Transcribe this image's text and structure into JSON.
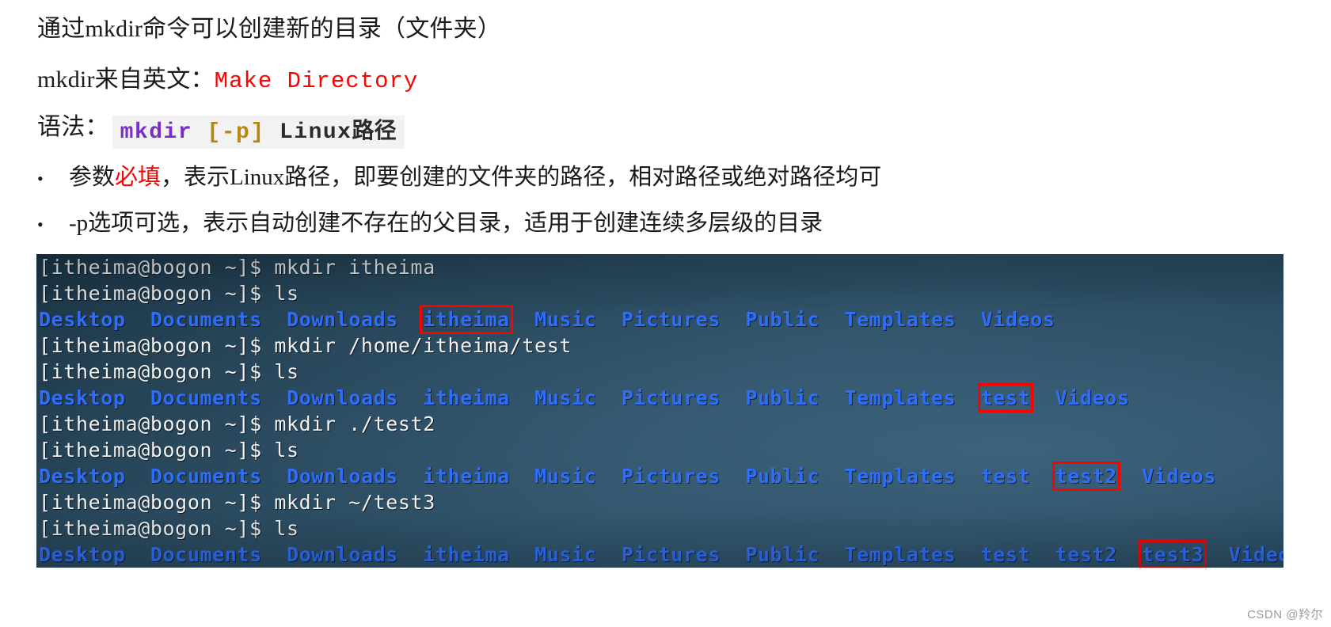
{
  "slide": {
    "heading_1": "通过mkdir命令可以创建新的目录（文件夹）",
    "line2_prefix": "mkdir来自英文：",
    "line2_english": "Make Directory",
    "line3_prefix": "语法：",
    "syntax": {
      "command": "mkdir",
      "space1": " ",
      "option": "[-p]",
      "space2": " ",
      "arg_latin": "Linux",
      "arg_cjk": "路径"
    },
    "bullets": [
      {
        "marker": "•",
        "pre": "参数",
        "emphasis": "必填",
        "post": "，表示Linux路径，即要创建的文件夹的路径，相对路径或绝对路径均可"
      },
      {
        "marker": "•",
        "pre": "-p选项可选，表示自动创建不存在的父目录，适用于创建连续多层级的目录",
        "emphasis": "",
        "post": ""
      }
    ]
  },
  "terminal": {
    "prompt": "[itheima@bogon ~]$ ",
    "colors": {
      "background": "#2c4a60",
      "prompt_text": "#f2f2f2",
      "directory": "#2f6dfb",
      "highlight_box": "#ff0000"
    },
    "lines": [
      {
        "kind": "command",
        "prompt": "[itheima@bogon ~]$ ",
        "command": "mkdir itheima"
      },
      {
        "kind": "command",
        "prompt": "[itheima@bogon ~]$ ",
        "command": "ls"
      },
      {
        "kind": "listing",
        "items": [
          "Desktop",
          "Documents",
          "Downloads",
          "itheima",
          "Music",
          "Pictures",
          "Public",
          "Templates",
          "Videos"
        ],
        "highlight": "itheima"
      },
      {
        "kind": "command",
        "prompt": "[itheima@bogon ~]$ ",
        "command": "mkdir /home/itheima/test"
      },
      {
        "kind": "command",
        "prompt": "[itheima@bogon ~]$ ",
        "command": "ls"
      },
      {
        "kind": "listing",
        "items": [
          "Desktop",
          "Documents",
          "Downloads",
          "itheima",
          "Music",
          "Pictures",
          "Public",
          "Templates",
          "test",
          "Videos"
        ],
        "highlight": "test"
      },
      {
        "kind": "command",
        "prompt": "[itheima@bogon ~]$ ",
        "command": "mkdir ./test2"
      },
      {
        "kind": "command",
        "prompt": "[itheima@bogon ~]$ ",
        "command": "ls"
      },
      {
        "kind": "listing",
        "items": [
          "Desktop",
          "Documents",
          "Downloads",
          "itheima",
          "Music",
          "Pictures",
          "Public",
          "Templates",
          "test",
          "test2",
          "Videos"
        ],
        "highlight": "test2"
      },
      {
        "kind": "command",
        "prompt": "[itheima@bogon ~]$ ",
        "command": "mkdir ~/test3"
      },
      {
        "kind": "command",
        "prompt": "[itheima@bogon ~]$ ",
        "command": "ls"
      },
      {
        "kind": "listing",
        "items": [
          "Desktop",
          "Documents",
          "Downloads",
          "itheima",
          "Music",
          "Pictures",
          "Public",
          "Templates",
          "test",
          "test2",
          "test3",
          "Videos"
        ],
        "highlight": "test3"
      }
    ]
  },
  "watermark": {
    "text": "CSDN @羚尔"
  }
}
